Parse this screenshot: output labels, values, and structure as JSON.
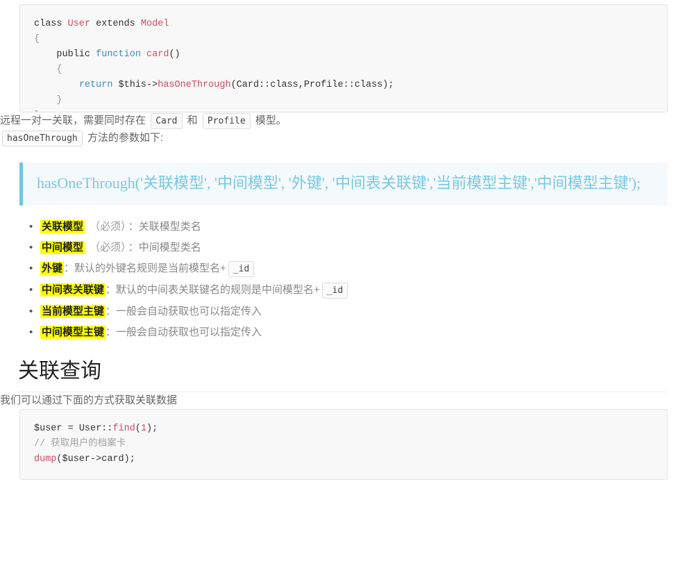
{
  "code_top": {
    "lines": [
      [
        {
          "t": "class ",
          "c": "tok-kw"
        },
        {
          "t": "User",
          "c": "tok-cls"
        },
        {
          "t": " extends ",
          "c": "tok-kw"
        },
        {
          "t": "Model",
          "c": "tok-cls"
        }
      ],
      [
        {
          "t": "{",
          "c": "tok-brace"
        }
      ],
      [
        {
          "t": "    public ",
          "c": "tok-kw"
        },
        {
          "t": "function ",
          "c": "tok-fnkw"
        },
        {
          "t": "card",
          "c": "tok-fn"
        },
        {
          "t": "()",
          "c": "tok-punc"
        }
      ],
      [
        {
          "t": "    {",
          "c": "tok-brace"
        }
      ],
      [
        {
          "t": "        ",
          "c": "tok-kw"
        },
        {
          "t": "return",
          "c": "tok-ret"
        },
        {
          "t": " $this->",
          "c": "tok-var"
        },
        {
          "t": "hasOneThrough",
          "c": "tok-fn"
        },
        {
          "t": "(Card::class,Profile::class);",
          "c": "tok-punc"
        }
      ],
      [
        {
          "t": "    }",
          "c": "tok-brace"
        }
      ],
      [
        {
          "t": "}",
          "c": "tok-brace"
        }
      ]
    ],
    "plain": "class User extends Model\n{\n    public function card()\n    {\n        return $this->hasOneThrough(Card::class,Profile::class);\n    }\n}"
  },
  "intro": {
    "before": "远程一对一关联，需要同时存在",
    "code1": "Card",
    "middle": "和",
    "code2": "Profile",
    "after": "模型。"
  },
  "params_line": {
    "code": "hasOneThrough",
    "after": "方法的参数如下:"
  },
  "quote": {
    "text": "hasOneThrough('关联模型', '中间模型', '外键', '中间表关联键','当前模型主键','中间模型主键');",
    "accent": "#6ec8e4",
    "bg": "#f4f9fb",
    "color": "#79c8e3"
  },
  "params": [
    {
      "term": "关联模型",
      "note": "（必须）",
      "sep": "：",
      "desc": "关联模型类名",
      "code": ""
    },
    {
      "term": "中间模型",
      "note": "（必须）",
      "sep": "：",
      "desc": "中间模型类名",
      "code": ""
    },
    {
      "term": "外键",
      "note": "",
      "sep": "：",
      "desc": "默认的外键名规则是当前模型名+",
      "code": "_id"
    },
    {
      "term": "中间表关联键",
      "note": "",
      "sep": "：",
      "desc": "默认的中间表关联键名的规则是中间模型名+",
      "code": "_id"
    },
    {
      "term": "当前模型主键",
      "note": "",
      "sep": "：",
      "desc": "一般会自动获取也可以指定传入",
      "code": ""
    },
    {
      "term": "中间模型主键",
      "note": "",
      "sep": "：",
      "desc": "一般会自动获取也可以指定传入",
      "code": ""
    }
  ],
  "highlight_color": "#ffff00",
  "section": {
    "heading": "关联查询",
    "paragraph": "我们可以通过下面的方式获取关联数据"
  },
  "code_bottom": {
    "lines": [
      [
        {
          "t": "$user ",
          "c": "tok-var"
        },
        {
          "t": "= ",
          "c": "tok-punc"
        },
        {
          "t": "User::",
          "c": "tok-kw"
        },
        {
          "t": "find",
          "c": "tok-fn"
        },
        {
          "t": "(",
          "c": "tok-punc"
        },
        {
          "t": "1",
          "c": "tok-num"
        },
        {
          "t": ");",
          "c": "tok-punc"
        }
      ],
      [
        {
          "t": "// 获取用户的档案卡",
          "c": "tok-cmt"
        }
      ],
      [
        {
          "t": "dump",
          "c": "tok-fn"
        },
        {
          "t": "($user->card);",
          "c": "tok-punc"
        }
      ]
    ],
    "plain": "$user = User::find(1);\n// 获取用户的档案卡\ndump($user->card);"
  }
}
